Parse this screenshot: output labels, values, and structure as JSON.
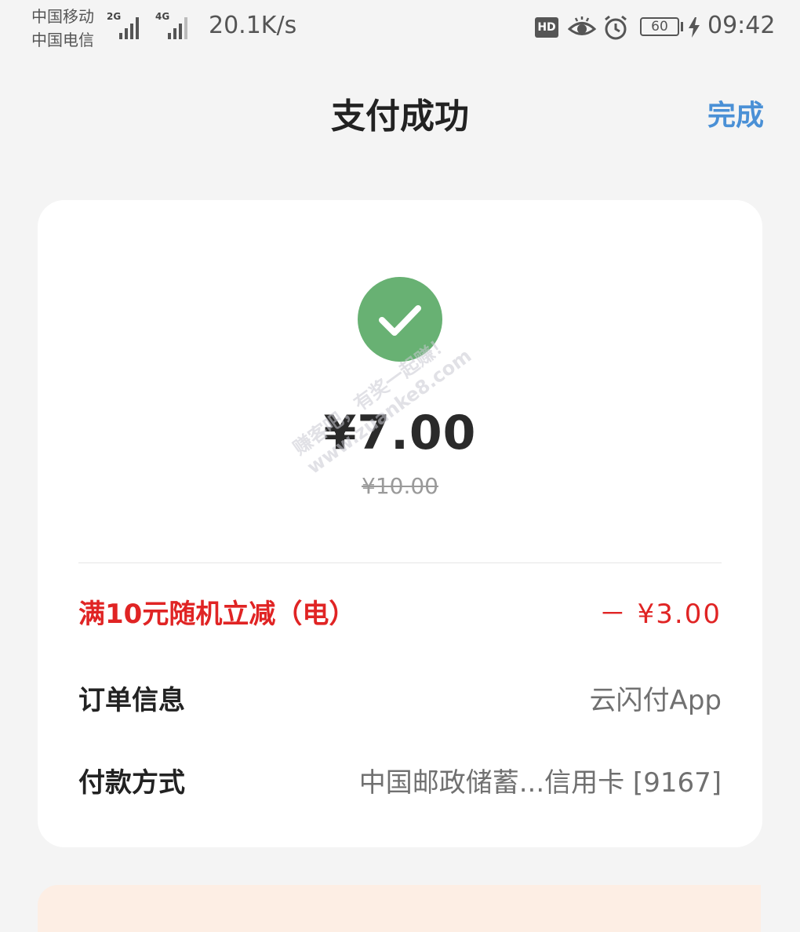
{
  "status_bar": {
    "carrier_1": "中国移动",
    "carrier_2": "中国电信",
    "signal_1_tech": "2G",
    "signal_2_tech": "4G",
    "net_speed": "20.1K/s",
    "hd_label": "HD",
    "battery_level": "60",
    "time": "09:42",
    "icons": [
      "hd-icon",
      "eye-icon",
      "alarm-icon",
      "battery-icon",
      "charging-icon"
    ]
  },
  "header": {
    "title": "支付成功",
    "done_label": "完成",
    "done_color": "#4a90d6"
  },
  "payment": {
    "status_icon": "checkmark-icon",
    "status_color": "#68b173",
    "amount": "¥7.00",
    "original_amount": "¥10.00",
    "details": [
      {
        "label": "满10元随机立减（电）",
        "value": "－ ¥3.00"
      },
      {
        "label": "订单信息",
        "value": "云闪付App"
      },
      {
        "label": "付款方式",
        "value": "中国邮政储蓄...信用卡 [9167]"
      }
    ],
    "discount_color": "#e02424"
  },
  "watermark": {
    "line_1": "赚客吧，有奖一起赚！",
    "line_2": "www.zuanke8.com"
  }
}
